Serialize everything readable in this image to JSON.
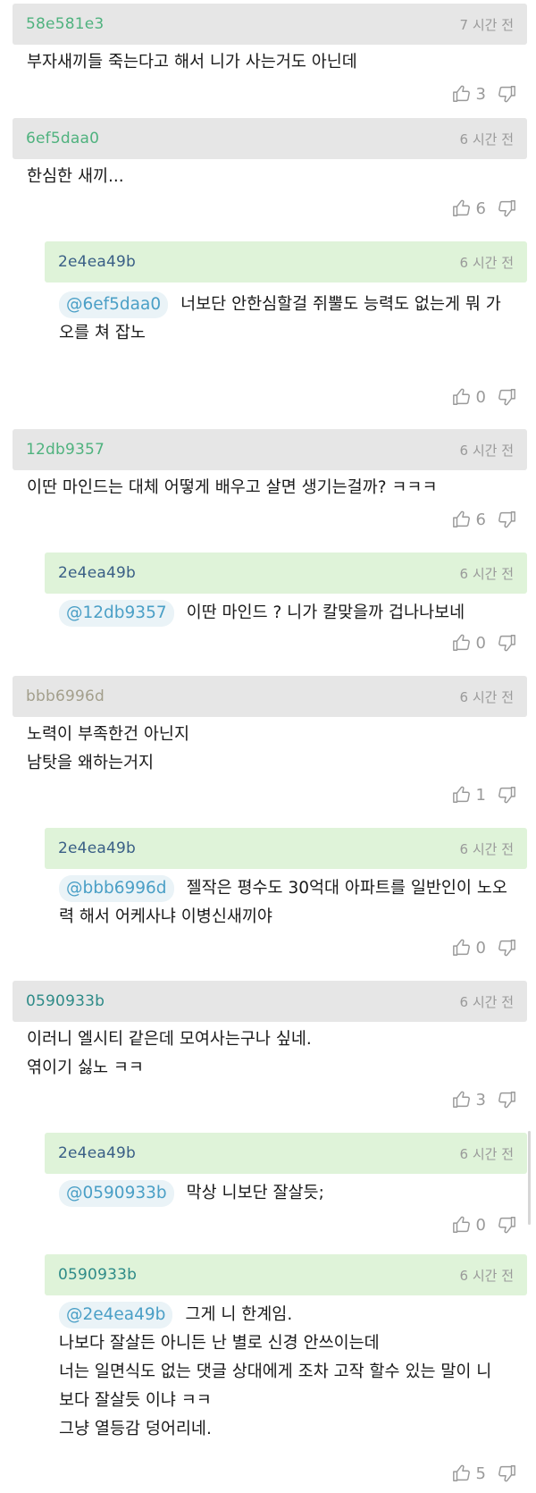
{
  "comments": [
    {
      "id": "58e581e3",
      "time": "7 시간 전",
      "text": "부자새끼들 죽는다고 해서 니가 사는거도 아닌데",
      "likes": "3",
      "idColor": "#4fb27e"
    },
    {
      "id": "6ef5daa0",
      "time": "6 시간 전",
      "text": "한심한 새끼...",
      "likes": "6",
      "idColor": "#4fb27e"
    },
    {
      "id": "2e4ea49b",
      "time": "6 시간 전",
      "mention": "@6ef5daa0",
      "text": "너보단 안한심할걸 쥐뿔도 능력도 없는게 뭐 가\n오를 쳐 잡노",
      "likes": "0",
      "idColor": "#3a5f86"
    },
    {
      "id": "12db9357",
      "time": "6 시간 전",
      "text": "이딴 마인드는 대체 어떻게 배우고 살면 생기는걸까? ㅋㅋㅋ",
      "likes": "6",
      "idColor": "#4fb27e"
    },
    {
      "id": "2e4ea49b",
      "time": "6 시간 전",
      "mention": "@12db9357",
      "text": "이딴 마인드 ? 니가 칼맞을까 겁나나보네",
      "likes": "0",
      "idColor": "#3a5f86"
    },
    {
      "id": "bbb6996d",
      "time": "6 시간 전",
      "text": "노력이 부족한건 아닌지\n남탓을 왜하는거지",
      "likes": "1",
      "idColor": "#a39f8c"
    },
    {
      "id": "2e4ea49b",
      "time": "6 시간 전",
      "mention": "@bbb6996d",
      "text": "젤작은 평수도 30억대 아파트를 일반인이 노오\n력 해서 어케사냐 이병신새끼야",
      "likes": "0",
      "idColor": "#3a5f86"
    },
    {
      "id": "0590933b",
      "time": "6 시간 전",
      "text": "이러니 엘시티 같은데 모여사는구나 싶네.\n엮이기 싫노 ㅋㅋ",
      "likes": "3",
      "idColor": "#2e8b88"
    },
    {
      "id": "2e4ea49b",
      "time": "6 시간 전",
      "mention": "@0590933b",
      "text": "막상 니보단 잘살듯;",
      "likes": "0",
      "idColor": "#3a5f86"
    },
    {
      "id": "0590933b",
      "time": "6 시간 전",
      "mention": "@2e4ea49b",
      "text": "그게 니 한계임.\n나보다 잘살든 아니든 난 별로 신경 안쓰이는데\n너는 일면식도 없는 댓글 상대에게 조차 고작 할수 있는 말이 니\n보다 잘살듯 이냐 ㅋㅋ\n그냥 열등감 덩어리네.",
      "likes": "5",
      "idColor": "#2e8b88"
    }
  ],
  "colors": {
    "topHeaderBg": "#e6e6e6",
    "replyHeaderBg": "#dff3d9",
    "mentionBg": "#eaf3f7",
    "mentionText": "#4a9fc6",
    "timeText": "#9a9a9a"
  },
  "icons": {
    "like": "thumbs-up-icon",
    "dislike": "thumbs-down-icon"
  }
}
